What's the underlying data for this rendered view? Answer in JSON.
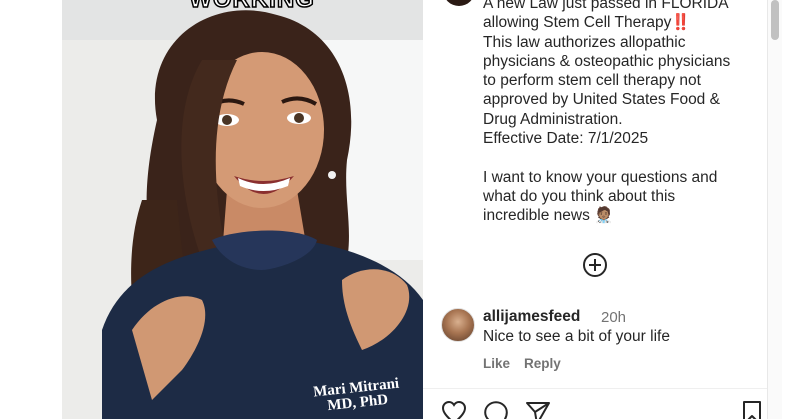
{
  "video": {
    "overlay_caption": "WORKING",
    "shirt_text_line1": "Mari Mitrani",
    "shirt_text_line2": "MD, PhD"
  },
  "post": {
    "caption_line1": "A new Law just passed in FLORIDA",
    "caption_line2_pre": "allowing Stem Cell Therapy",
    "caption_line2_emoji": "‼️",
    "caption_body": "This law authorizes allopathic\nphysicians & osteopathic physicians\nto perform stem cell therapy not\napproved by United States Food &\nDrug Administration.\nEffective Date: 7/1/2025\n\nI want to know your questions and\nwhat do you think about this\nincredible news 🧑🏽‍⚕️"
  },
  "comment": {
    "username": "allijamesfeed",
    "time": "20h",
    "text": "Nice to see a bit of your life",
    "like_label": "Like",
    "reply_label": "Reply"
  },
  "icons": {
    "add": "plus-circle-icon",
    "like": "heart-icon",
    "comment": "comment-icon",
    "share": "send-icon",
    "save": "bookmark-icon"
  }
}
